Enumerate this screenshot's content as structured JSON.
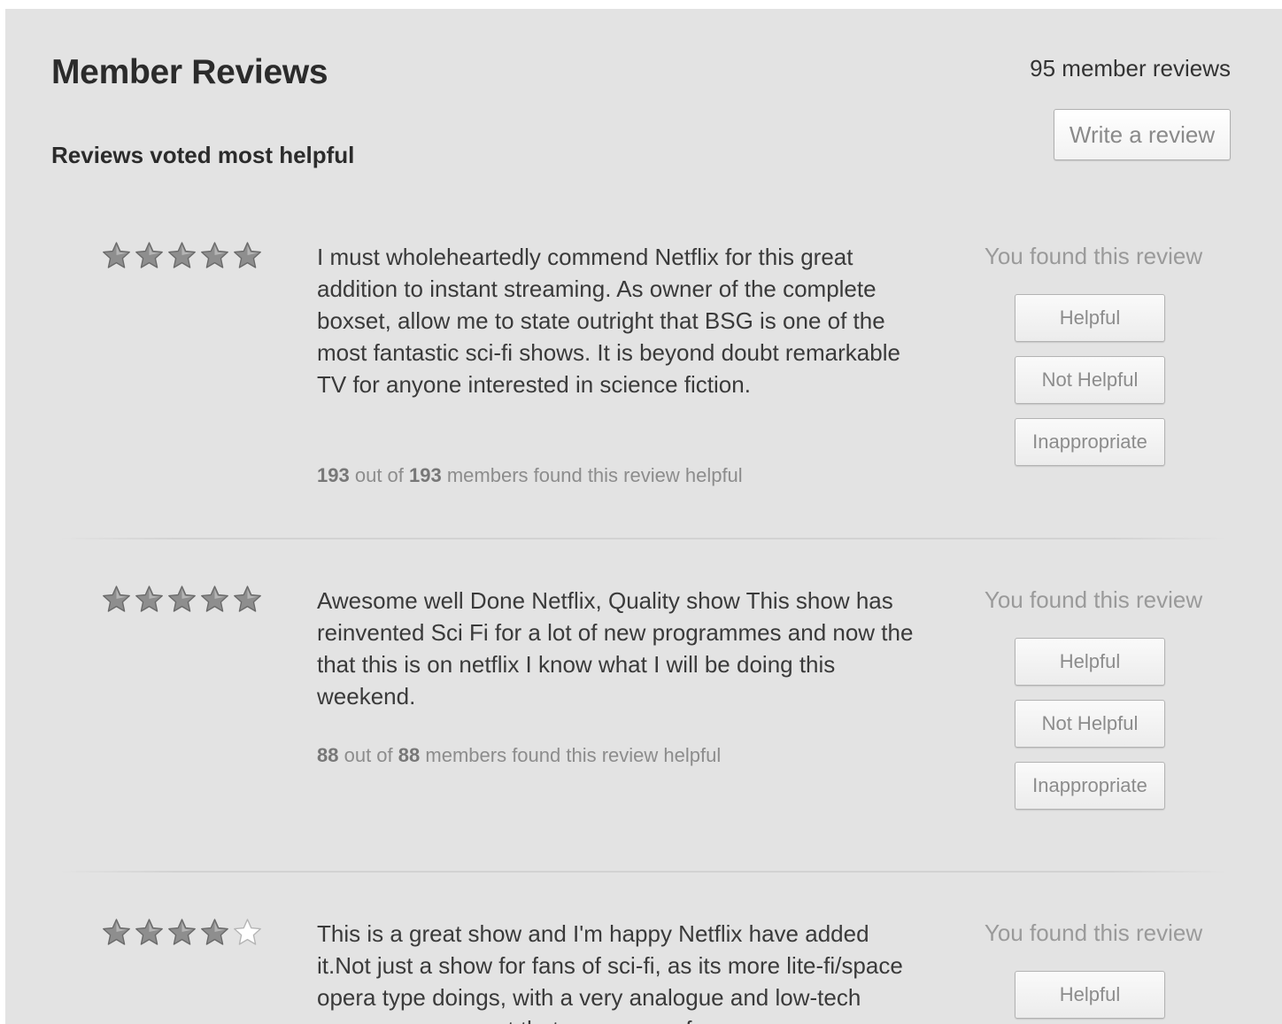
{
  "header": {
    "title": "Member Reviews",
    "subtitle": "Reviews voted most helpful",
    "review_count": "95 member reviews",
    "write_review_label": "Write a review"
  },
  "colors": {
    "panel_bg": "#e3e3e3",
    "star_filled": "#8e8e8e",
    "star_empty": "#ffffff"
  },
  "reviews": [
    {
      "rating": 5,
      "max_rating": 5,
      "text": "I must wholeheartedly commend Netflix for this great addition to instant streaming. As owner of the complete boxset, allow me to state outright that BSG is one of the most fantastic sci-fi shows. It is beyond doubt remarkable TV for anyone interested in science fiction.",
      "helpful_count": "193",
      "helpful_total": "193",
      "helpful_sep": "out of",
      "helpful_suffix": "members found this review helpful",
      "vote_prompt": "You found this review",
      "buttons": {
        "helpful": "Helpful",
        "not_helpful": "Not Helpful",
        "inappropriate": "Inappropriate"
      }
    },
    {
      "rating": 5,
      "max_rating": 5,
      "text": "Awesome well Done Netflix, Quality show This show has reinvented Sci Fi for a lot of new programmes and now the that this is on netflix I know what I will be doing this weekend.",
      "helpful_count": "88",
      "helpful_total": "88",
      "helpful_sep": "out of",
      "helpful_suffix": "members found this review helpful",
      "vote_prompt": "You found this review",
      "buttons": {
        "helpful": "Helpful",
        "not_helpful": "Not Helpful",
        "inappropriate": "Inappropriate"
      }
    },
    {
      "rating": 4,
      "max_rating": 5,
      "text": "This is a great show and I'm happy Netflix have added it.Not just a show for fans of sci-fi, as its more lite-fi/space opera type doings, with a very analogue and low-tech appearance, so not that are weary of",
      "vote_prompt": "You found this review",
      "buttons": {
        "helpful": "Helpful"
      }
    }
  ]
}
